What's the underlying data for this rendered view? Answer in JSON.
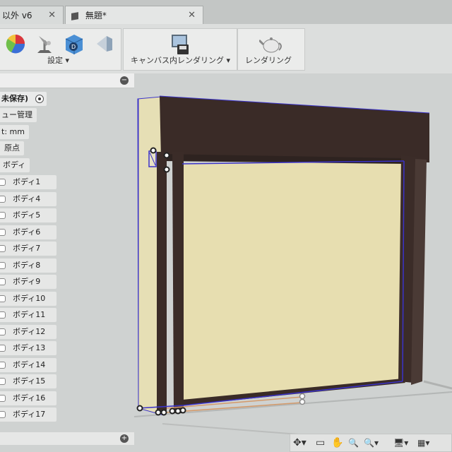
{
  "tabs": [
    {
      "label": "以外 v6",
      "close": "✕"
    },
    {
      "label": "無題*",
      "close": "✕"
    }
  ],
  "toolbar": {
    "groups": [
      {
        "label": "設定 ▾",
        "icons": [
          "appearance-icon",
          "scene-settings-icon",
          "texture-map-icon",
          "decal-icon"
        ]
      },
      {
        "label": "キャンバス内レンダリング ▾",
        "icons": [
          "in-canvas-render-icon"
        ]
      },
      {
        "label": "レンダリング",
        "icons": [
          "teapot-render-icon"
        ]
      }
    ]
  },
  "browser": {
    "collapse_button": "−",
    "root_label": "未保存)",
    "items": [
      {
        "label": "ュー管理"
      },
      {
        "label": "t: mm"
      },
      {
        "label": "原点"
      },
      {
        "label": "ボディ"
      }
    ],
    "bodies": [
      "ボディ1",
      "ボディ4",
      "ボディ5",
      "ボディ6",
      "ボディ7",
      "ボディ8",
      "ボディ9",
      "ボディ10",
      "ボディ11",
      "ボディ12",
      "ボディ13",
      "ボディ14",
      "ボディ15",
      "ボディ16",
      "ボディ17"
    ],
    "bottom_button": "+"
  },
  "navbar": {
    "icons": [
      "orbit-icon",
      "pan-icon",
      "zoom-icon",
      "zoom-window-icon",
      "display-settings-icon",
      "grid-settings-icon"
    ],
    "glyphs": [
      "✥▾",
      "▭",
      "✋",
      "🔍",
      "🔍▾",
      "🖥▾",
      "▦▾"
    ]
  },
  "colors": {
    "panel_fill": "#e8dfb0",
    "frame_dark": "#3a2a26",
    "selection_blue": "#3b33c9",
    "background": "#cfd2d1"
  }
}
